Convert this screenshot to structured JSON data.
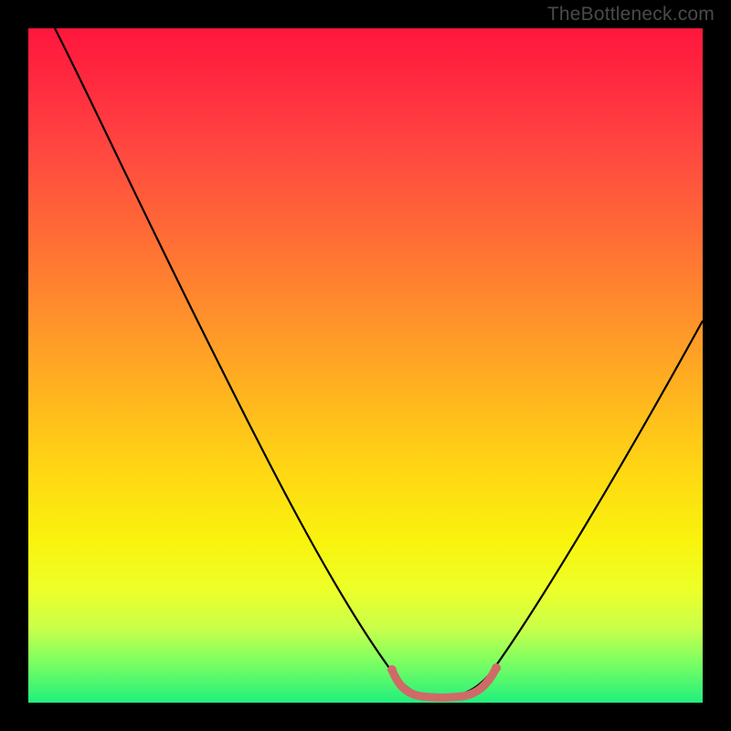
{
  "watermark_text": "TheBottleneck.com",
  "chart_data": {
    "type": "line",
    "title": "",
    "xlabel": "",
    "ylabel": "",
    "xlim": [
      0,
      100
    ],
    "ylim": [
      0,
      100
    ],
    "series": [
      {
        "name": "bottleneck-curve",
        "x": [
          4,
          10,
          16,
          22,
          28,
          34,
          40,
          46,
          50,
          53,
          56,
          59,
          62,
          65,
          68,
          72,
          78,
          84,
          90,
          96,
          100
        ],
        "y": [
          100,
          90,
          80,
          70,
          60,
          50,
          40,
          28,
          18,
          10,
          4,
          1,
          0.5,
          1,
          4,
          10,
          20,
          30,
          40,
          50,
          57
        ]
      },
      {
        "name": "optimal-range-marker",
        "x": [
          54,
          56,
          58,
          60,
          62,
          64,
          66,
          68,
          70
        ],
        "y": [
          3.5,
          1.2,
          0.6,
          0.5,
          0.5,
          0.6,
          1.0,
          2.0,
          4.2
        ]
      }
    ],
    "gradient_stops": [
      {
        "pos": 0,
        "color": "#ff173d"
      },
      {
        "pos": 8,
        "color": "#ff2a3f"
      },
      {
        "pos": 18,
        "color": "#ff4740"
      },
      {
        "pos": 30,
        "color": "#ff6a36"
      },
      {
        "pos": 42,
        "color": "#ff8e2c"
      },
      {
        "pos": 54,
        "color": "#ffb41f"
      },
      {
        "pos": 66,
        "color": "#ffd813"
      },
      {
        "pos": 76,
        "color": "#f9f30d"
      },
      {
        "pos": 83,
        "color": "#eeff28"
      },
      {
        "pos": 89,
        "color": "#c9ff4a"
      },
      {
        "pos": 94,
        "color": "#7cff62"
      },
      {
        "pos": 100,
        "color": "#21ef7c"
      }
    ],
    "colors": {
      "curve_main": "#000000",
      "optimal_marker": "#cf6a69",
      "frame": "#000000"
    }
  }
}
